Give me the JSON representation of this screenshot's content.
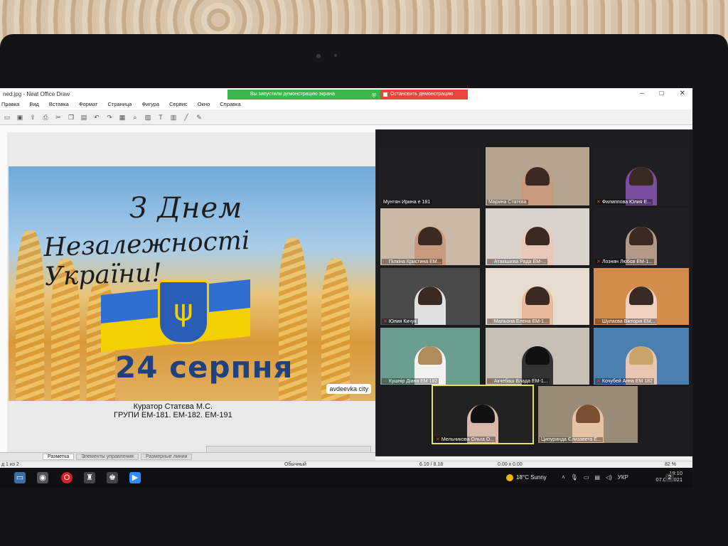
{
  "window": {
    "title": "ned.jpg - Neat Office Draw",
    "share_banner": "Вы запустили демонстрацию экрана",
    "stop_share": "Остановить демонстрацию",
    "minimize": "–",
    "maximize": "□",
    "close": "✕"
  },
  "menu": [
    "Правка",
    "Вид",
    "Вставка",
    "Формат",
    "Страница",
    "Фигура",
    "Сервис",
    "Окно",
    "Справка"
  ],
  "toolbar_icons": [
    "new-icon",
    "save-icon",
    "export-icon",
    "print-icon",
    "cut-icon",
    "copy-icon",
    "paste-icon",
    "undo-icon",
    "redo-icon",
    "grid-icon",
    "zoom-icon",
    "image-icon",
    "text-icon",
    "chart-icon",
    "line-icon",
    "pencil-icon"
  ],
  "poster": {
    "line1": "З Днем",
    "line2": "Незалежності України!",
    "date": "24 серпня",
    "watermark": "avdeevka city"
  },
  "caption": {
    "line1": "Куратор Статєва М.С.",
    "line2": "ГРУПИ ЕМ-181. ЕМ-182. ЕМ-191"
  },
  "tabs": [
    "Разметка",
    "Элементы управления",
    "Размерные линии"
  ],
  "status": {
    "page": "д 1 из 2",
    "style": "Обычный",
    "position": "6.10 / 8.18",
    "size": "0.00 x 0.00",
    "zoom": "82 %"
  },
  "participants": [
    {
      "name": "Мунтян Ирина е 181",
      "muted": false
    },
    {
      "name": "Марина Статєва",
      "muted": false
    },
    {
      "name": "Филиппова Юлия Е...",
      "muted": true
    },
    {
      "name": "Пілкіна Кристина ЕМ...",
      "muted": true
    },
    {
      "name": "Атакішієва Рада ЕМ-...",
      "muted": true
    },
    {
      "name": "Лознян Любов ЕМ-1...",
      "muted": true
    },
    {
      "name": "Юлия Кичук",
      "muted": true
    },
    {
      "name": "Мальона Елена ЕМ-1...",
      "muted": true
    },
    {
      "name": "Шулаєва Вікторія ЕМ...",
      "muted": true
    },
    {
      "name": "Кушнір Діана ЕМ 182",
      "muted": true
    },
    {
      "name": "Акчебаш Влада ЕМ-1...",
      "muted": true
    },
    {
      "name": "Кочубей Анна ЕМ 182",
      "muted": true
    },
    {
      "name": "Мельникова Ольга О...",
      "muted": true
    },
    {
      "name": "Ципуринда Єлизавета Е...",
      "muted": false
    }
  ],
  "taskbar": {
    "weather": "18°C  Sunny",
    "lang": "УКР",
    "time": "19:10",
    "date": "07.09.2021",
    "notif": "2"
  }
}
